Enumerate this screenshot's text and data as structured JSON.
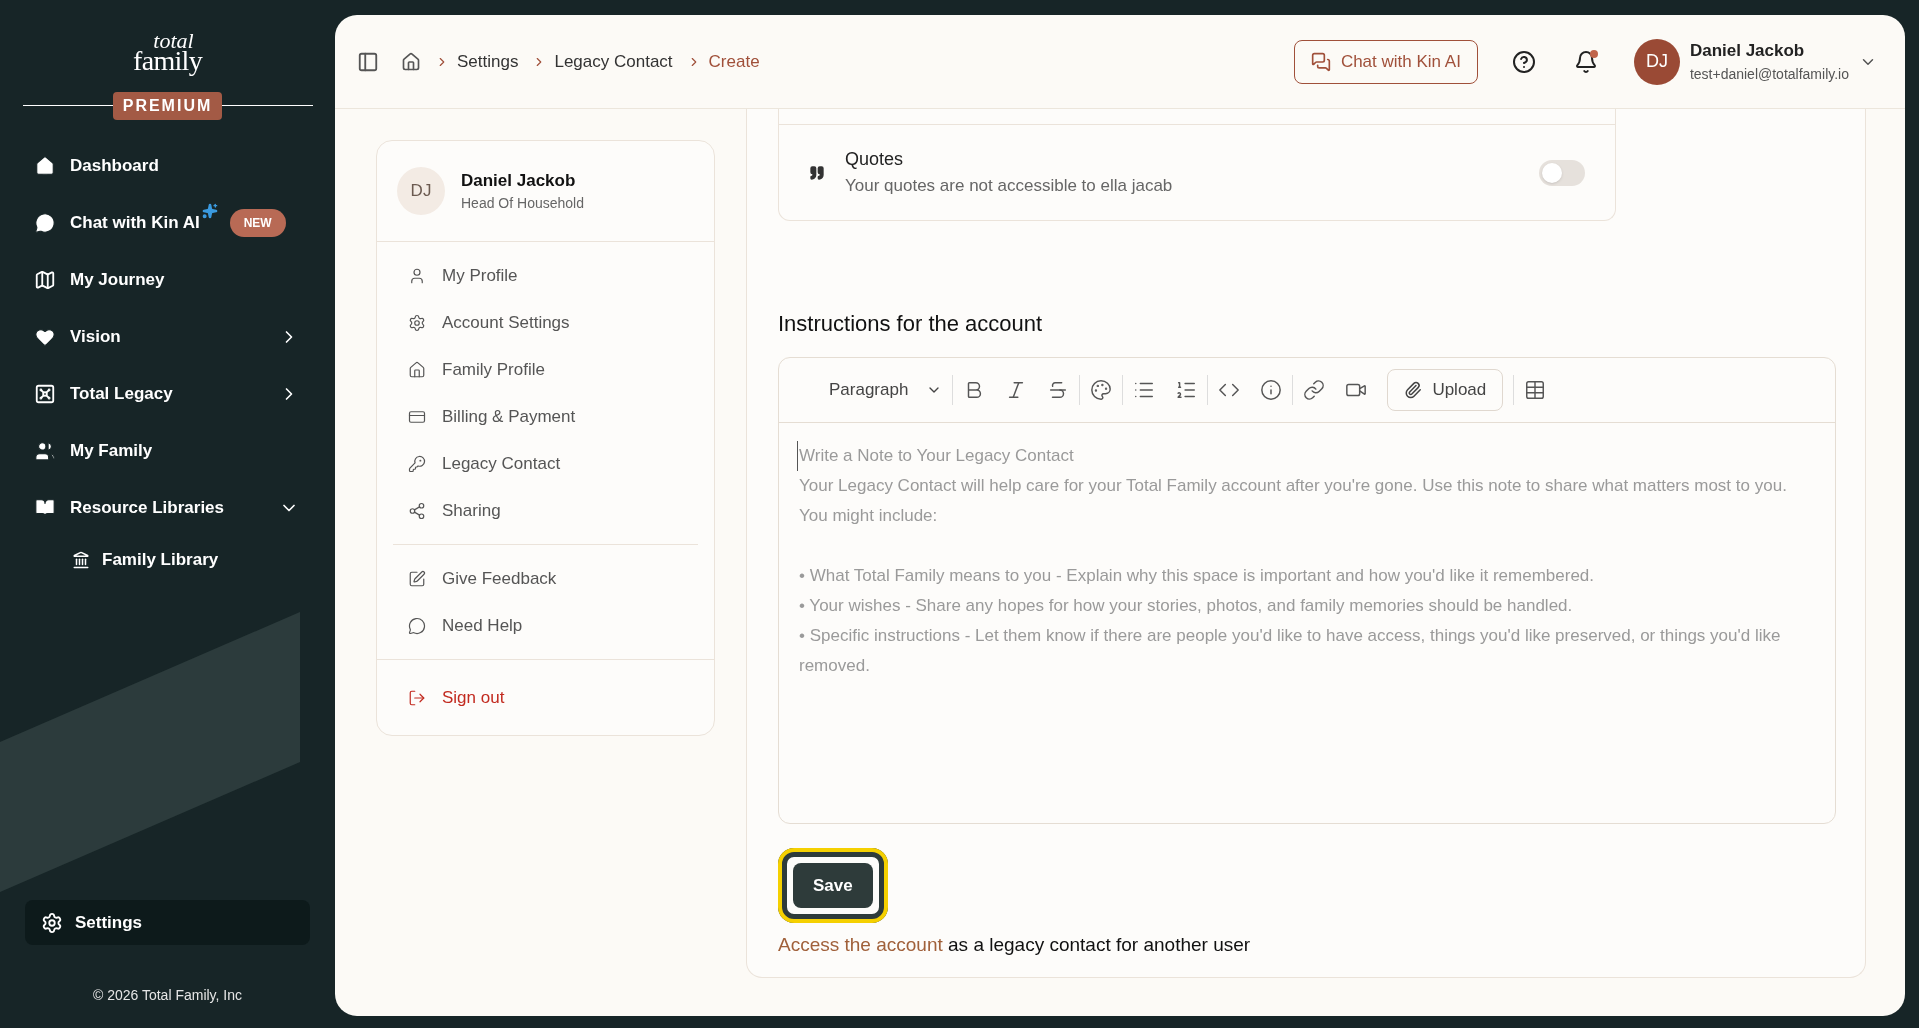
{
  "logo": {
    "line1": "total",
    "line2": "family"
  },
  "plan_badge": "PREMIUM",
  "sidebar": {
    "items": [
      {
        "label": "Dashboard",
        "selected": false
      },
      {
        "label": "Chat with Kin AI",
        "badge": "NEW",
        "selected": false
      },
      {
        "label": "My Journey",
        "selected": false
      },
      {
        "label": "Vision",
        "expanded": false,
        "selected": false
      },
      {
        "label": "Total Legacy",
        "expanded": false,
        "selected": false
      },
      {
        "label": "My Family",
        "selected": false
      },
      {
        "label": "Resource Libraries",
        "expanded": true,
        "selected": false,
        "children": [
          {
            "label": "Family Library",
            "selected": false
          }
        ]
      }
    ],
    "settings": {
      "label": "Settings",
      "selected": true
    },
    "copyright": "© 2026 Total Family, Inc"
  },
  "breadcrumbs": [
    {
      "label": "Settings",
      "selected": false
    },
    {
      "label": "Legacy Contact",
      "selected": false
    },
    {
      "label": "Create",
      "selected": true
    }
  ],
  "header": {
    "chat_button": "Chat with Kin AI",
    "notifications_unread": true,
    "user": {
      "initials": "DJ",
      "name": "Daniel Jackob",
      "email": "test+daniel@totalfamily.io"
    }
  },
  "settings_menu": {
    "user": {
      "initials": "DJ",
      "name": "Daniel Jackob",
      "role": "Head Of Household"
    },
    "groups": [
      [
        {
          "label": "My Profile",
          "kind": "normal"
        },
        {
          "label": "Account Settings",
          "kind": "normal"
        },
        {
          "label": "Family Profile",
          "kind": "normal"
        },
        {
          "label": "Billing & Payment",
          "kind": "normal"
        },
        {
          "label": "Legacy Contact",
          "kind": "normal"
        },
        {
          "label": "Sharing",
          "kind": "normal"
        }
      ],
      [
        {
          "label": "Give Feedback",
          "kind": "normal"
        },
        {
          "label": "Need Help",
          "kind": "normal"
        }
      ],
      [
        {
          "label": "Sign out",
          "kind": "danger"
        }
      ]
    ]
  },
  "permissions": [
    {
      "title": "Quotes",
      "description": "Your quotes are not accessible to ella jacab",
      "on": false
    }
  ],
  "instructions": {
    "heading": "Instructions for the account",
    "toolbar": [
      [
        {
          "kind": "paragraph",
          "label": "Paragraph"
        }
      ],
      [
        {
          "kind": "bold"
        },
        {
          "kind": "italic"
        },
        {
          "kind": "strike"
        }
      ],
      [
        {
          "kind": "palette"
        }
      ],
      [
        {
          "kind": "bullets"
        },
        {
          "kind": "numbers"
        }
      ],
      [
        {
          "kind": "code"
        },
        {
          "kind": "info"
        }
      ],
      [
        {
          "kind": "link"
        },
        {
          "kind": "video"
        },
        {
          "kind": "upload",
          "label": "Upload"
        }
      ],
      [
        {
          "kind": "table"
        }
      ]
    ],
    "placeholder": [
      "Write a Note to Your Legacy Contact",
      "Your Legacy Contact will help care for your Total Family account after you're gone. Use this note to share what matters most to you. You might include:"
    ],
    "placeholder_bullets": [
      "• What Total Family means to you - Explain why this space is important and how you'd like it remembered.",
      "• Your wishes - Share any hopes for how your stories, photos, and family memories should be handled.",
      "• Specific instructions - Let them know if there are people you'd like to have access, things you'd like preserved, or things you'd like removed."
    ]
  },
  "save_button": {
    "label": "Save",
    "focused": true
  },
  "access_note": {
    "link": "Access the account",
    "text": "as a legacy contact for another user"
  }
}
